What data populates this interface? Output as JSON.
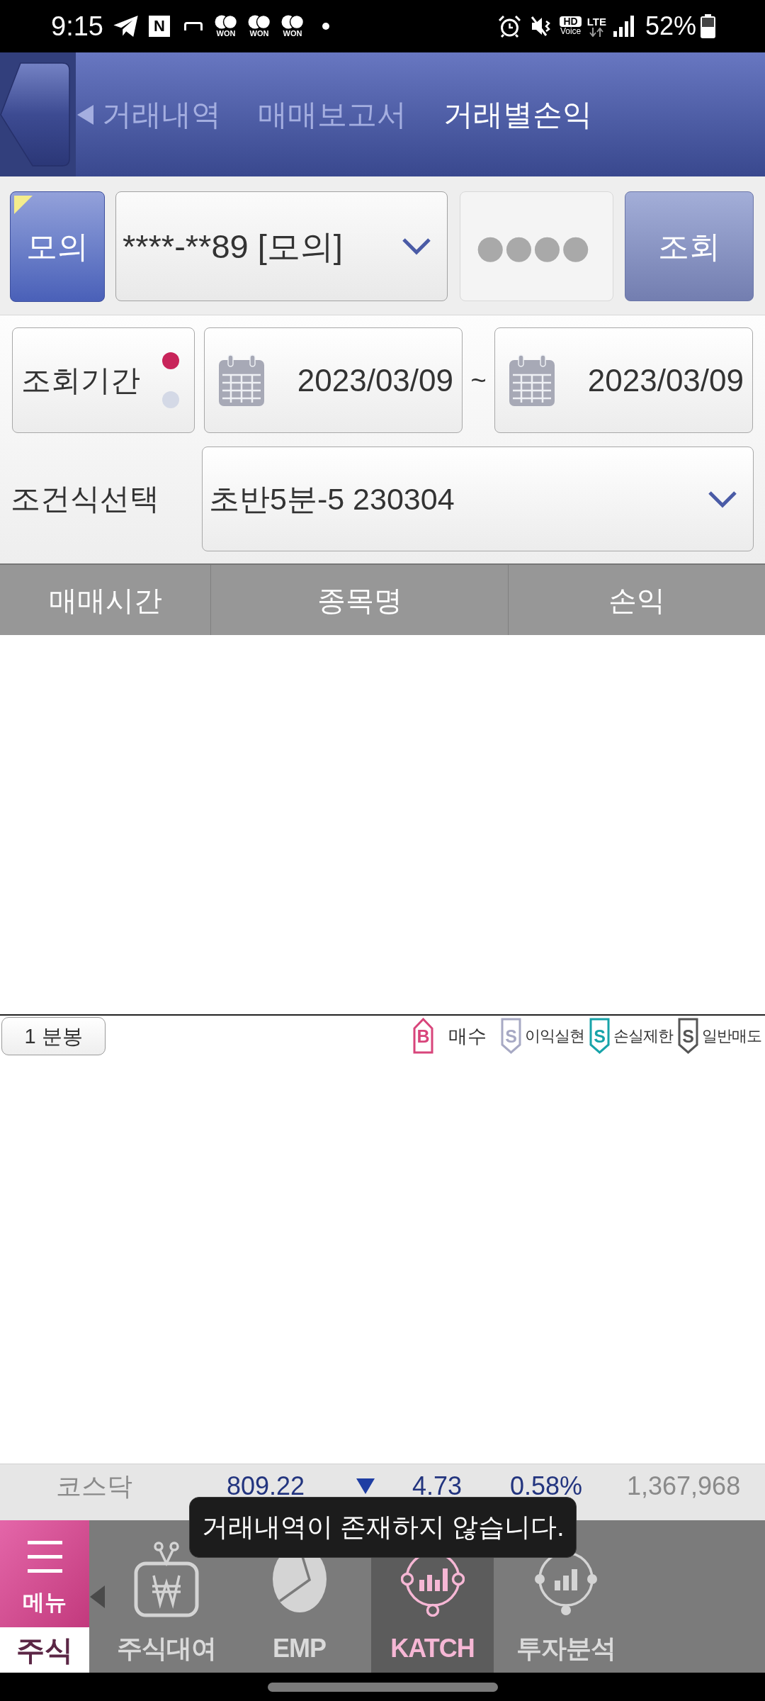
{
  "status_bar": {
    "time": "9:15",
    "notification_letter": "N",
    "coin_labels": [
      "WON",
      "WON",
      "WON"
    ],
    "hd_label": "HD",
    "voice_label": "Voice",
    "network": "LTE",
    "battery": "52%"
  },
  "header": {
    "tabs": [
      {
        "label": "거래내역",
        "selected": false
      },
      {
        "label": "매매보고서",
        "selected": false
      },
      {
        "label": "거래별손익",
        "selected": true
      }
    ]
  },
  "account_bar": {
    "mode_button": "모의",
    "account": "****-**89 [모의]",
    "password": "●●●●",
    "search_button": "조회"
  },
  "period": {
    "label": "조회기간",
    "toggle": [
      {
        "selected": true
      },
      {
        "selected": false
      }
    ],
    "date_from": "2023/03/09",
    "separator": "~",
    "date_to": "2023/03/09"
  },
  "condition": {
    "label": "조건식선택",
    "value": "초반5분-5 230304"
  },
  "table": {
    "columns": [
      "매매시간",
      "종목명",
      "손익"
    ]
  },
  "chart_legend": {
    "interval_button": "1 분봉",
    "items": [
      {
        "kind": "buy",
        "badge": "B",
        "label": "매수",
        "color": "#d8457b"
      },
      {
        "kind": "sell",
        "badge": "S",
        "label": "이익실현",
        "color": "#a7a9c4"
      },
      {
        "kind": "sell",
        "badge": "S",
        "label": "손실제한",
        "color": "#17a3a9"
      },
      {
        "kind": "sell",
        "badge": "S",
        "label": "일반매도",
        "color": "#555555"
      }
    ]
  },
  "ticker": {
    "index": "코스닥",
    "value": "809.22",
    "falling": true,
    "change": "4.73",
    "percent": "0.58%",
    "volume": "1,367,968"
  },
  "toast": "거래내역이 존재하지 않습니다.",
  "bottom_nav": {
    "menu_label": "메뉴",
    "section": "주식",
    "items": [
      {
        "label": "주식대여",
        "selected": false
      },
      {
        "label": "EMP",
        "selected": false
      },
      {
        "label": "KATCH",
        "selected": true
      },
      {
        "label": "투자분석",
        "selected": false
      }
    ]
  }
}
